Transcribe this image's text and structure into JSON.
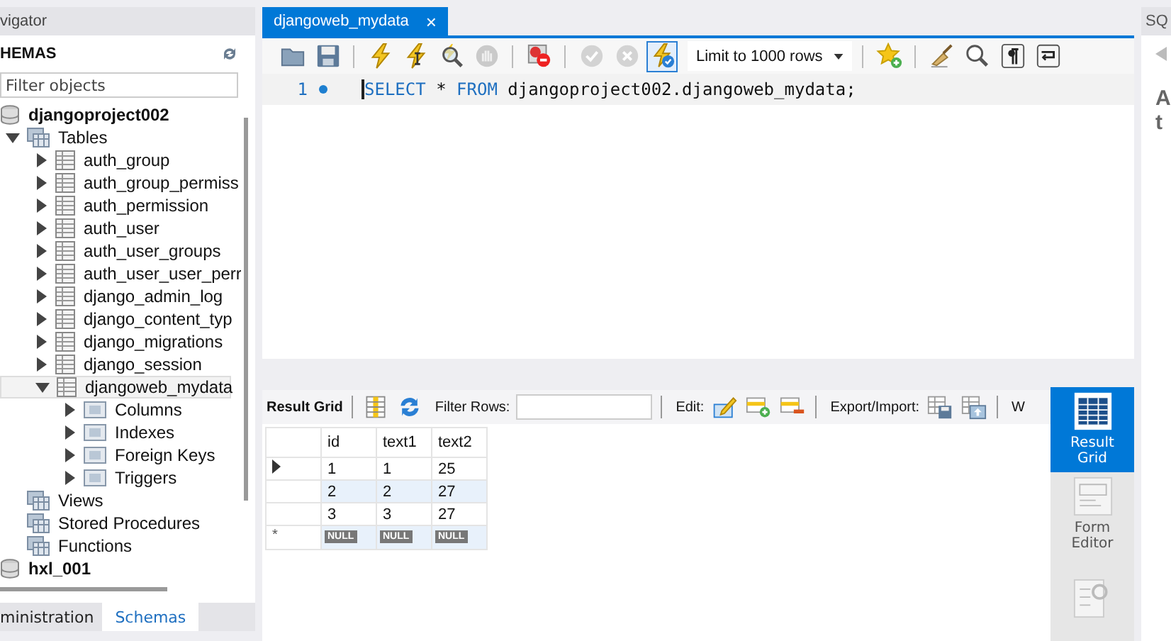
{
  "navigator": {
    "title": "vigator",
    "section": "HEMAS",
    "filter": {
      "placeholder": "Filter objects"
    },
    "tree": [
      {
        "label": "djangoproject002",
        "kind": "schema",
        "selected": false,
        "children": [
          {
            "label": "Tables",
            "kind": "folder",
            "expanded": true,
            "selected": false,
            "children": [
              {
                "label": "auth_group",
                "kind": "table",
                "expanded": false,
                "selected": false
              },
              {
                "label": "auth_group_permiss",
                "kind": "table",
                "expanded": false,
                "selected": false
              },
              {
                "label": "auth_permission",
                "kind": "table",
                "expanded": false,
                "selected": false
              },
              {
                "label": "auth_user",
                "kind": "table",
                "expanded": false,
                "selected": false
              },
              {
                "label": "auth_user_groups",
                "kind": "table",
                "expanded": false,
                "selected": false
              },
              {
                "label": "auth_user_user_perr",
                "kind": "table",
                "expanded": false,
                "selected": false
              },
              {
                "label": "django_admin_log",
                "kind": "table",
                "expanded": false,
                "selected": false
              },
              {
                "label": "django_content_typ",
                "kind": "table",
                "expanded": false,
                "selected": false
              },
              {
                "label": "django_migrations",
                "kind": "table",
                "expanded": false,
                "selected": false
              },
              {
                "label": "django_session",
                "kind": "table",
                "expanded": false,
                "selected": false
              },
              {
                "label": "djangoweb_mydata",
                "kind": "table",
                "expanded": true,
                "selected": true,
                "children": [
                  {
                    "label": "Columns",
                    "kind": "subfolder",
                    "expanded": false,
                    "selected": false
                  },
                  {
                    "label": "Indexes",
                    "kind": "subfolder",
                    "expanded": false,
                    "selected": false
                  },
                  {
                    "label": "Foreign Keys",
                    "kind": "subfolder",
                    "expanded": false,
                    "selected": false
                  },
                  {
                    "label": "Triggers",
                    "kind": "subfolder",
                    "expanded": false,
                    "selected": false
                  }
                ]
              }
            ]
          },
          {
            "label": "Views",
            "kind": "folder",
            "selected": false
          },
          {
            "label": "Stored Procedures",
            "kind": "folder",
            "selected": false
          },
          {
            "label": "Functions",
            "kind": "folder",
            "selected": false
          }
        ]
      },
      {
        "label": "hxl_001",
        "kind": "schema",
        "selected": false
      }
    ],
    "bottom_tabs": [
      {
        "label": "ministration",
        "selected": false
      },
      {
        "label": "Schemas",
        "selected": true
      }
    ]
  },
  "editor_tab": {
    "title": "djangoweb_mydata",
    "close": "×"
  },
  "toolbar": [
    {
      "kind": "open",
      "disabled": false,
      "on": false
    },
    {
      "kind": "save",
      "disabled": false,
      "on": false
    },
    {
      "kind": "separator"
    },
    {
      "kind": "execute",
      "disabled": false,
      "on": false
    },
    {
      "kind": "execute-current",
      "disabled": false,
      "on": false
    },
    {
      "kind": "explain",
      "disabled": false,
      "on": false
    },
    {
      "kind": "stop",
      "disabled": true,
      "on": false
    },
    {
      "kind": "separator"
    },
    {
      "kind": "stop-on-error",
      "disabled": false,
      "on": false
    },
    {
      "kind": "separator"
    },
    {
      "kind": "commit",
      "disabled": true,
      "on": false
    },
    {
      "kind": "rollback",
      "disabled": true,
      "on": false
    },
    {
      "kind": "autocommit",
      "disabled": false,
      "on": true
    },
    {
      "kind": "dropdown",
      "value": "Limit to 1000 rows"
    },
    {
      "kind": "separator"
    },
    {
      "kind": "bookmark",
      "disabled": false,
      "on": false
    },
    {
      "kind": "separator"
    },
    {
      "kind": "beautify",
      "disabled": false,
      "on": false
    },
    {
      "kind": "find",
      "disabled": false,
      "on": false
    },
    {
      "kind": "invisible",
      "disabled": false,
      "on": false
    },
    {
      "kind": "wrap",
      "disabled": false,
      "on": false
    }
  ],
  "editor": {
    "lines": [
      {
        "number": "1",
        "marker": true,
        "tokens": [
          {
            "text": "SELECT",
            "kind": "keyword"
          },
          {
            "text": " * ",
            "kind": "plain"
          },
          {
            "text": "FROM",
            "kind": "keyword"
          },
          {
            "text": " djangoproject002.djangoweb_mydata;",
            "kind": "plain"
          }
        ]
      }
    ]
  },
  "result_toolbar": [
    {
      "kind": "title",
      "text": "Result Grid"
    },
    {
      "kind": "separator"
    },
    {
      "kind": "grid-toggle"
    },
    {
      "kind": "refresh"
    },
    {
      "kind": "label",
      "text": "Filter Rows:"
    },
    {
      "kind": "filter"
    },
    {
      "kind": "separator"
    },
    {
      "kind": "label",
      "text": "Edit:"
    },
    {
      "kind": "edit-cell"
    },
    {
      "kind": "add-row"
    },
    {
      "kind": "delete-row"
    },
    {
      "kind": "separator"
    },
    {
      "kind": "label",
      "text": "Export/Import:"
    },
    {
      "kind": "export"
    },
    {
      "kind": "import"
    },
    {
      "kind": "separator"
    },
    {
      "kind": "label",
      "text": "W"
    }
  ],
  "table": {
    "columns": [
      "id",
      "text1",
      "text2"
    ],
    "rows": [
      {
        "cells": [
          "1",
          "1",
          "25"
        ],
        "selected": true
      },
      {
        "cells": [
          "2",
          "2",
          "27"
        ],
        "selected": false
      },
      {
        "cells": [
          "3",
          "3",
          "27"
        ],
        "selected": false
      }
    ],
    "new_row": {
      "marker": "*",
      "cells": [
        "NULL",
        "NULL",
        "NULL"
      ]
    }
  },
  "result_side": [
    {
      "label": "Result Grid",
      "kind": "grid",
      "selected": true
    },
    {
      "label": "Form Editor",
      "kind": "form",
      "selected": false
    },
    {
      "kind": "field-types",
      "selected": false
    }
  ],
  "right_panel": {
    "tab": "SQ",
    "lines": [
      "A",
      "t"
    ]
  }
}
